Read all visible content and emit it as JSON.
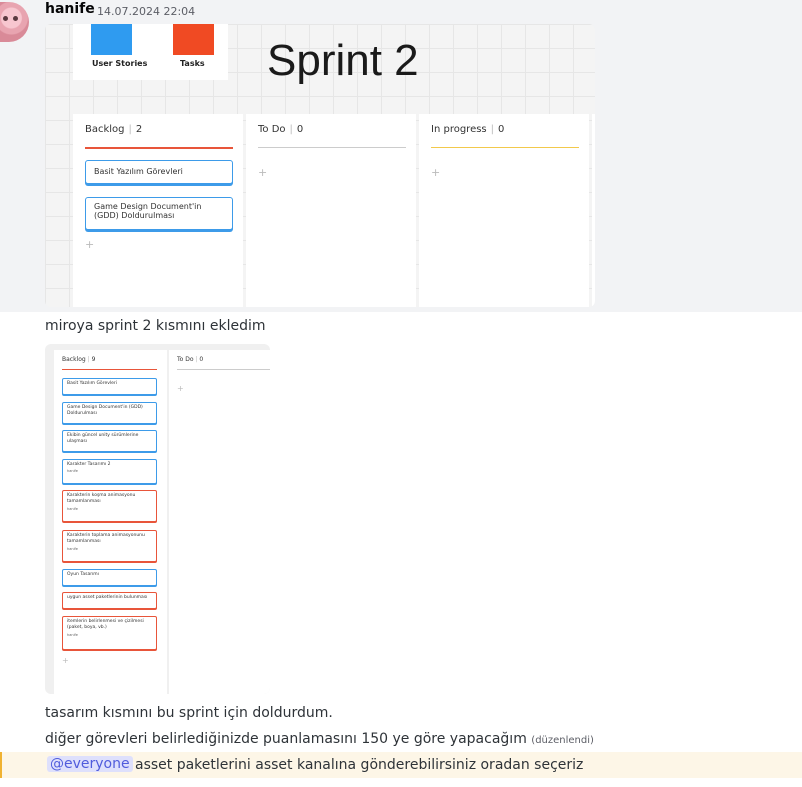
{
  "message": {
    "username": "hanife",
    "timestamp": "14.07.2024 22:04",
    "lines": [
      "miroya sprint 2 kısmını ekledim",
      "tasarım kısmını bu sprint için doldurdum.",
      "diğer görevleri belirlediğinizde puanlamasını 150 ye göre yapacağım"
    ],
    "edited_label": "(düzenlendi)",
    "mention": "@everyone",
    "mention_text": "asset paketlerini asset kanalına gönderebilirsiniz oradan seçeriz"
  },
  "board1": {
    "legend": [
      {
        "label": "User Stories",
        "color": "#2f9bf0"
      },
      {
        "label": "Tasks",
        "color": "#f04a23"
      }
    ],
    "title": "Sprint 2",
    "columns": [
      {
        "name": "Backlog",
        "count": "2",
        "line_color": "#e8553a",
        "cards": [
          "Basit Yazılım Görevleri",
          "Game Design Document'in (GDD) Doldurulması"
        ]
      },
      {
        "name": "To Do",
        "count": "0",
        "line_color": "#cccccc",
        "cards": []
      },
      {
        "name": "In progress",
        "count": "0",
        "line_color": "#f2c94c",
        "cards": []
      }
    ],
    "plus": "+"
  },
  "board2": {
    "columns": [
      {
        "name": "Backlog",
        "count": "9",
        "line_color": "#e8553a"
      },
      {
        "name": "To Do",
        "count": "0",
        "line_color": "#cccccc"
      }
    ],
    "cards": [
      {
        "text": "Basit Yazılım Görevleri",
        "color": "#3d9be9",
        "who": ""
      },
      {
        "text": "Game Design Document'in (GDD) Doldurulması",
        "color": "#3d9be9",
        "who": ""
      },
      {
        "text": "Ekibin güncel unity sürümlerine ulaşması",
        "color": "#3d9be9",
        "who": ""
      },
      {
        "text": "Karakter Tasarımı 2",
        "color": "#3d9be9",
        "who": "hanife"
      },
      {
        "text": "Karakterin koşma animasyonu tamamlanması",
        "color": "#e8553a",
        "who": "hanife"
      },
      {
        "text": "Karakterin toplama animasyonunu tamamlanması",
        "color": "#e8553a",
        "who": "hanife"
      },
      {
        "text": "Oyun Tasarımı",
        "color": "#3d9be9",
        "who": ""
      },
      {
        "text": "uygun asset paketlerinin bulunması",
        "color": "#e8553a",
        "who": ""
      },
      {
        "text": "itemlerin belirlenmesi ve çizilmesi (paket, boya, vb.)",
        "color": "#e8553a",
        "who": "hanife"
      }
    ]
  }
}
